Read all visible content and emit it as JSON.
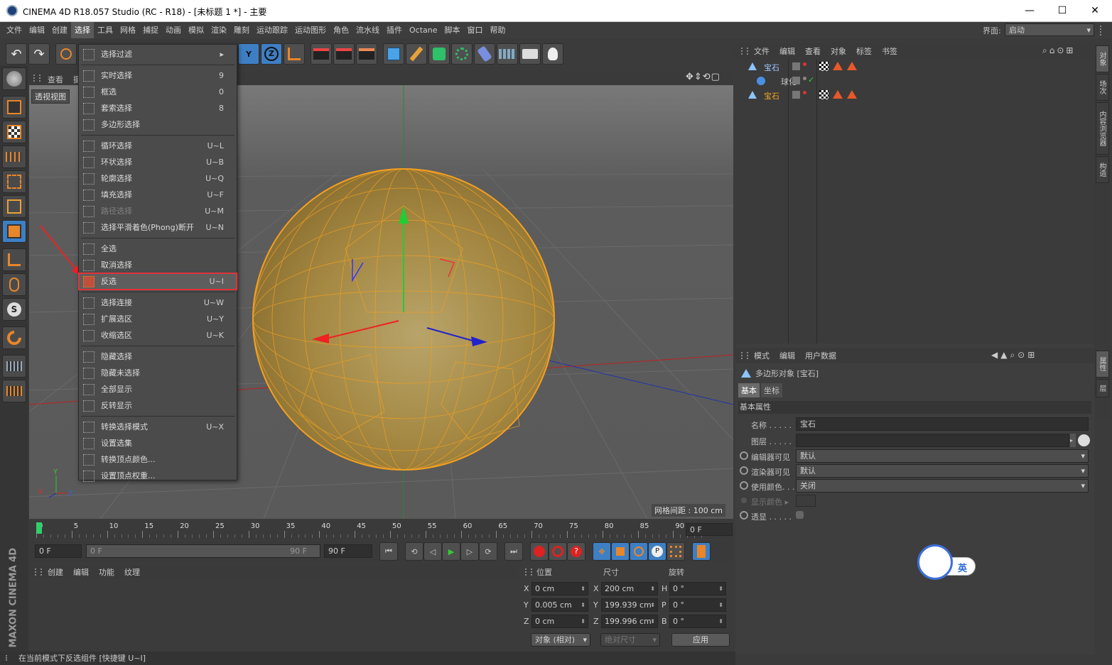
{
  "window": {
    "title": "CINEMA 4D R18.057 Studio (RC - R18) - [未标题 1 *] - 主要",
    "minimize": "—",
    "maximize": "☐",
    "close": "✕"
  },
  "menubar": {
    "items": [
      "文件",
      "编辑",
      "创建",
      "选择",
      "工具",
      "网格",
      "捕捉",
      "动画",
      "模拟",
      "渲染",
      "雕刻",
      "运动跟踪",
      "运动图形",
      "角色",
      "流水线",
      "插件",
      "Octane",
      "脚本",
      "窗口",
      "帮助"
    ],
    "active_index": 3,
    "layout_label": "界面:",
    "layout_value": "启动"
  },
  "viewport": {
    "menu": [
      "查看",
      "摄"
    ],
    "name": "透视视图",
    "grid_label": "网格间距 : 100 cm",
    "axis_y": "Y",
    "axis_x": "X",
    "axis_z": "Z"
  },
  "dropdown": {
    "items": [
      {
        "label": "选择过滤",
        "shortcut": "▸",
        "disabled": false,
        "sep_after": true
      },
      {
        "label": "实时选择",
        "shortcut": "9"
      },
      {
        "label": "框选",
        "shortcut": "0"
      },
      {
        "label": "套索选择",
        "shortcut": "8"
      },
      {
        "label": "多边形选择",
        "shortcut": "",
        "sep_after": true
      },
      {
        "label": "循环选择",
        "shortcut": "U~L"
      },
      {
        "label": "环状选择",
        "shortcut": "U~B"
      },
      {
        "label": "轮廓选择",
        "shortcut": "U~Q"
      },
      {
        "label": "填充选择",
        "shortcut": "U~F"
      },
      {
        "label": "路径选择",
        "shortcut": "U~M",
        "disabled": true
      },
      {
        "label": "选择平滑着色(Phong)断开",
        "shortcut": "U~N",
        "sep_after": true
      },
      {
        "label": "全选",
        "shortcut": ""
      },
      {
        "label": "取消选择",
        "shortcut": ""
      },
      {
        "label": "反选",
        "shortcut": "U~I",
        "highlight": true,
        "sep_after": true
      },
      {
        "label": "选择连接",
        "shortcut": "U~W"
      },
      {
        "label": "扩展选区",
        "shortcut": "U~Y"
      },
      {
        "label": "收缩选区",
        "shortcut": "U~K",
        "sep_after": true
      },
      {
        "label": "隐藏选择",
        "shortcut": ""
      },
      {
        "label": "隐藏未选择",
        "shortcut": ""
      },
      {
        "label": "全部显示",
        "shortcut": ""
      },
      {
        "label": "反转显示",
        "shortcut": "",
        "sep_after": true
      },
      {
        "label": "转换选择模式",
        "shortcut": "U~X"
      },
      {
        "label": "设置选集",
        "shortcut": ""
      },
      {
        "label": "转换顶点颜色...",
        "shortcut": ""
      },
      {
        "label": "设置顶点权重...",
        "shortcut": ""
      }
    ]
  },
  "objects": {
    "menu": [
      "文件",
      "编辑",
      "查看",
      "对象",
      "标签",
      "书签"
    ],
    "rows": [
      {
        "name": "宝石",
        "color": "#9fc7ff"
      },
      {
        "name": "球化",
        "color": "#c8c8c8"
      },
      {
        "name": "宝石",
        "color": "#f5a623"
      }
    ]
  },
  "attributes": {
    "menu": [
      "模式",
      "编辑",
      "用户数据"
    ],
    "object_title": "多边形对象 [宝石]",
    "tabs": [
      "基本",
      "坐标"
    ],
    "section": "基本属性",
    "fields": {
      "name_label": "名称 . . . . .",
      "name_value": "宝石",
      "layer_label": "图层 . . . . .",
      "editor_vis_label": "编辑器可见",
      "editor_vis_value": "默认",
      "render_vis_label": "渲染器可见",
      "render_vis_value": "默认",
      "use_color_label": "使用颜色. . .",
      "use_color_value": "关闭",
      "display_color_label": "显示颜色 ▸",
      "xray_label": "透显 . . . . ."
    }
  },
  "side_tabs": {
    "right_top": [
      "对象",
      "场次",
      "内容浏览器",
      "构造"
    ],
    "right_bottom": [
      "属性",
      "层"
    ]
  },
  "timeline": {
    "ticks": [
      "0",
      "5",
      "10",
      "15",
      "20",
      "25",
      "30",
      "35",
      "40",
      "45",
      "50",
      "55",
      "60",
      "65",
      "70",
      "75",
      "80",
      "85",
      "90"
    ],
    "end_field": "0 F",
    "start_field": "0 F",
    "range_start": "0 F",
    "range_end": "90 F",
    "max_field": "90 F"
  },
  "material": {
    "menu": [
      "创建",
      "编辑",
      "功能",
      "纹理"
    ]
  },
  "coords": {
    "headers": [
      "位置",
      "尺寸",
      "旋转"
    ],
    "rows": [
      {
        "axis": "X",
        "pos": "0 cm",
        "sizeaxis": "X",
        "size": "200 cm",
        "rotaxis": "H",
        "rot": "0 °"
      },
      {
        "axis": "Y",
        "pos": "0.005 cm",
        "sizeaxis": "Y",
        "size": "199.939 cm",
        "rotaxis": "P",
        "rot": "0 °"
      },
      {
        "axis": "Z",
        "pos": "0 cm",
        "sizeaxis": "Z",
        "size": "199.996 cm",
        "rotaxis": "B",
        "rot": "0 °"
      }
    ],
    "mode": "对象 (相对)",
    "size_mode": "绝对尺寸",
    "apply": "应用"
  },
  "ime": {
    "label": "英"
  },
  "status": "在当前模式下反选组件 [快捷键 U~I]",
  "brand": "MAXON CINEMA 4D"
}
